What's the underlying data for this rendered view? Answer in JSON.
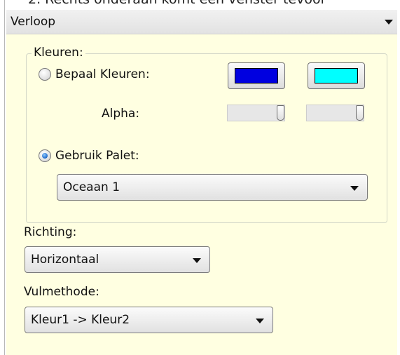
{
  "top_caption": "2. Rechts onderaan komt een venster tevoor",
  "panel": {
    "title": "Verloop"
  },
  "colors_group": {
    "legend": "Kleuren:",
    "option_custom": "Bepaal Kleuren:",
    "option_custom_selected": false,
    "color1": "#0000e0",
    "color2": "#00ffff",
    "alpha_label": "Alpha:",
    "alpha1": 1.0,
    "alpha2": 1.0,
    "option_palette": "Gebruik Palet:",
    "option_palette_selected": true,
    "palette_value": "Oceaan 1"
  },
  "direction": {
    "label": "Richting:",
    "value": "Horizontaal"
  },
  "fill": {
    "label": "Vulmethode:",
    "value": "Kleur1 -> Kleur2"
  }
}
